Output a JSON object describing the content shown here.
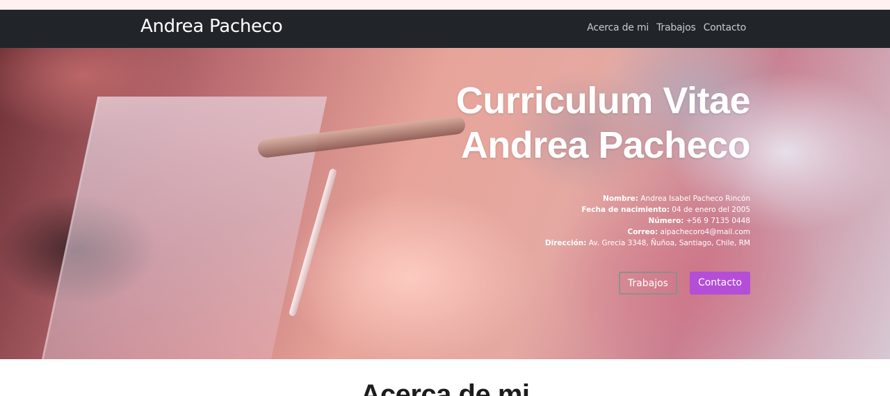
{
  "nav": {
    "brand": "Andrea Pacheco",
    "links": [
      "Acerca de mi",
      "Trabajos",
      "Contacto"
    ]
  },
  "hero": {
    "title_line1": "Curriculum Vitae",
    "title_line2": "Andrea Pacheco",
    "info": [
      {
        "label": "Nombre:",
        "value": " Andrea Isabel Pacheco Rincón"
      },
      {
        "label": "Fecha de nacimiento:",
        "value": " 04 de enero del 2005"
      },
      {
        "label": "Número:",
        "value": " +56 9 7135 0448"
      },
      {
        "label": "Correo:",
        "value": " aipachecoro4@mail.com"
      },
      {
        "label": "Dirección:",
        "value": " Av. Grecia 3348, Ñuñoa, Santiago, Chile, RM"
      }
    ],
    "buttons": {
      "works": "Trabajos",
      "contact": "Contacto"
    }
  },
  "about": {
    "title": "Acerca de mi"
  },
  "colors": {
    "navbar": "#212529",
    "accent": "#b44ed8",
    "top_strip": "#fdf1f1"
  }
}
